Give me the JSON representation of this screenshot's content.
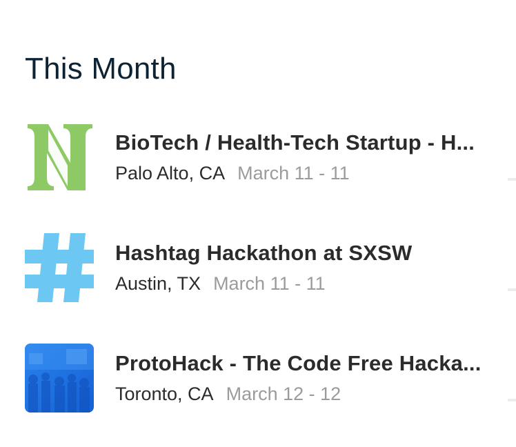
{
  "section": {
    "title": "This Month"
  },
  "events": [
    {
      "name": "BioTech / Health-Tech Startup - H...",
      "location": "Palo Alto, CA",
      "dates": "March 11 - 11",
      "logo_icon": "letter-n-logo",
      "logo_color": "#8dc965"
    },
    {
      "name": "Hashtag Hackathon at SXSW",
      "location": "Austin, TX",
      "dates": "March 11 - 11",
      "logo_icon": "hashtag-logo",
      "logo_color": "#6cc8f2"
    },
    {
      "name": "ProtoHack - The Code Free Hacka...",
      "location": "Toronto, CA",
      "dates": "March 12 - 12",
      "logo_icon": "crowd-photo-logo",
      "logo_color": "#1f73e0"
    }
  ]
}
